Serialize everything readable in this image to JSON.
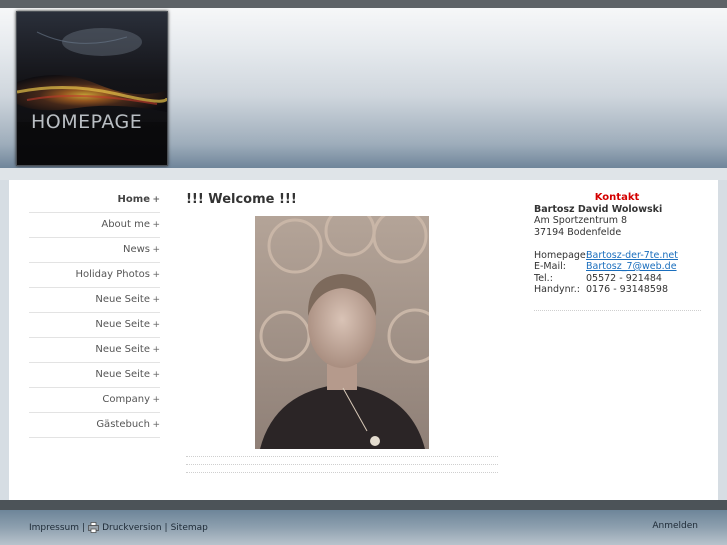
{
  "header": {
    "logo_text": "HOMEPAGE"
  },
  "nav": {
    "items": [
      {
        "label": "Home",
        "marker": "+"
      },
      {
        "label": "About me",
        "marker": "+"
      },
      {
        "label": "News",
        "marker": "+"
      },
      {
        "label": "Holiday Photos",
        "marker": "+"
      },
      {
        "label": "Neue Seite",
        "marker": "+"
      },
      {
        "label": "Neue Seite",
        "marker": "+"
      },
      {
        "label": "Neue Seite",
        "marker": "+"
      },
      {
        "label": "Neue Seite",
        "marker": "+"
      },
      {
        "label": "Company",
        "marker": "+"
      },
      {
        "label": "Gästebuch",
        "marker": "+"
      }
    ]
  },
  "main": {
    "title": "!!! Welcome !!!"
  },
  "contact": {
    "heading": "Kontakt",
    "name": "Bartosz David Wolowski",
    "street": "Am Sportzentrum 8",
    "city": "37194 Bodenfelde",
    "homepage_label": "Homepage:",
    "homepage_value": "Bartosz-der-7te.net",
    "email_label": "E-Mail:",
    "email_value": "Bartosz_7@web.de",
    "tel_label": "Tel.:",
    "tel_value": "05572 - 921484",
    "mobile_label": "Handynr.:",
    "mobile_value": "0176 - 93148598"
  },
  "footer": {
    "impressum": "Impressum",
    "sep1": "|",
    "print": "Druckversion",
    "sep2": "|",
    "sitemap": "Sitemap",
    "login": "Anmelden"
  },
  "colors": {
    "accent": "#d40000",
    "link": "#1a6ebd"
  }
}
